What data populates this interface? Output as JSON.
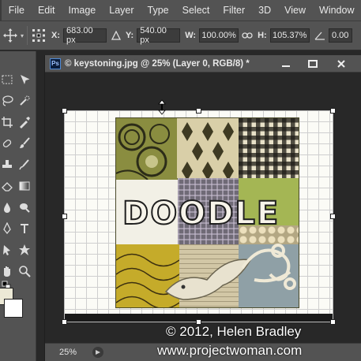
{
  "menu": [
    "File",
    "Edit",
    "Image",
    "Layer",
    "Type",
    "Select",
    "Filter",
    "3D",
    "View",
    "Window"
  ],
  "options": {
    "x_label": "X:",
    "x_value": "683.00 px",
    "y_label": "Y:",
    "y_value": "540.00 px",
    "w_label": "W:",
    "w_value": "100.00%",
    "h_label": "H:",
    "h_value": "105.37%",
    "angle_value": "0.00"
  },
  "document": {
    "ps_badge": "Ps",
    "title": "© keystoning.jpg @ 25% (Layer 0, RGB/8) *",
    "zoom": "25%"
  },
  "image": {
    "doodle_text": "DOODLE"
  },
  "watermark": {
    "line1": "© 2012, Helen Bradley",
    "line2": "www.projectwoman.com"
  },
  "colors": {
    "panel": "#535353",
    "dark": "#282828",
    "foreground_swatch": "#ece9d6",
    "background_swatch": "#ffffff"
  }
}
